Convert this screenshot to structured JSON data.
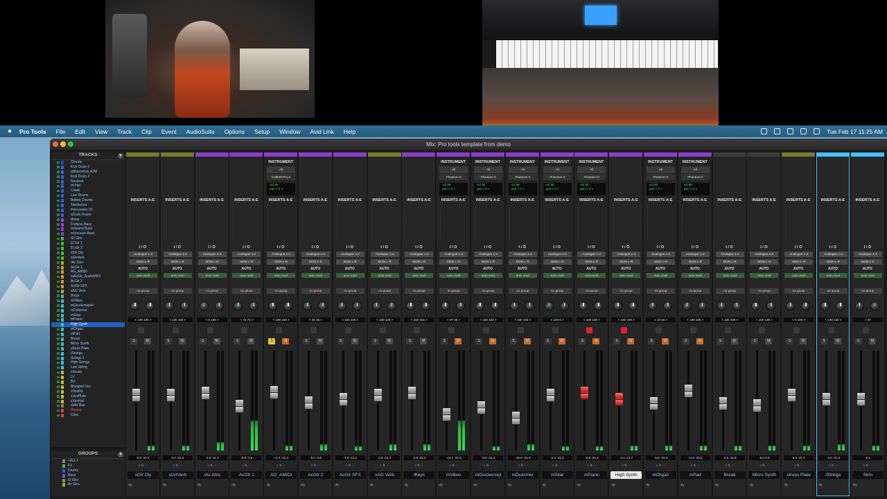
{
  "menubar": {
    "app_name": "Pro Tools",
    "items": [
      "File",
      "Edit",
      "View",
      "Track",
      "Clip",
      "Event",
      "AudioSuite",
      "Options",
      "Setup",
      "Window",
      "Avid Link",
      "Help"
    ],
    "clock": "Tue Feb 17  11:25 AM"
  },
  "window": {
    "title": "Mix: Pro tools template from demo"
  },
  "tracks_panel": {
    "title": "TRACKS",
    "tracks": [
      {
        "name": "/Drums",
        "color": "#1f4fbf"
      },
      {
        "name": "Kick Drum 1",
        "color": "#2f5fdf"
      },
      {
        "name": "mBoomKick A2M",
        "color": "#2f5fdf"
      },
      {
        "name": "Kick Drum 2",
        "color": "#2f5fdf"
      },
      {
        "name": "Rimshot",
        "color": "#2f5fdf"
      },
      {
        "name": "Hi Hat",
        "color": "#2f5fdf"
      },
      {
        "name": "Crash",
        "color": "#2f5fdf"
      },
      {
        "name": "Live Drums",
        "color": "#2f5fdf"
      },
      {
        "name": "Belted_Drums",
        "color": "#2f5fdf"
      },
      {
        "name": "Tamborine",
        "color": "#2f5fdf"
      },
      {
        "name": "Percussion 03",
        "color": "#2f5fdf"
      },
      {
        "name": "sDrum Room",
        "color": "#2f5fdf"
      },
      {
        "name": "/Bass",
        "color": "#8a3fd8"
      },
      {
        "name": "Fretless Bass",
        "color": "#8a3fd8"
      },
      {
        "name": "mXpand Bass",
        "color": "#8a3fd8"
      },
      {
        "name": "mVacuum Bass",
        "color": "#8a3fd8"
      },
      {
        "name": "/El Gtrs",
        "color": "#3fbf3f"
      },
      {
        "name": "El Gtr 1",
        "color": "#3fbf3f"
      },
      {
        "name": "El Gtr 2",
        "color": "#3fbf3f"
      },
      {
        "name": "xGtr Dly",
        "color": "#3fbf3f"
      },
      {
        "name": "xGtrVerb",
        "color": "#3fbf3f"
      },
      {
        "name": "/Ac Gtrs",
        "color": "#bf9f3f"
      },
      {
        "name": "AcGtr 1",
        "color": "#bf9f3f"
      },
      {
        "name": "AG_AMIDI",
        "color": "#bf9f3f"
      },
      {
        "name": "mAcGtr_AudioMIDI",
        "color": "#bf9f3f"
      },
      {
        "name": "AcGtr 2",
        "color": "#bf9f3f"
      },
      {
        "name": "AcGtr SFX",
        "color": "#bf9f3f"
      },
      {
        "name": "xAG Verb",
        "color": "#bf9f3f"
      },
      {
        "name": "/Keys",
        "color": "#3fbfbf"
      },
      {
        "name": "mVibes",
        "color": "#3fbfbf"
      },
      {
        "name": "mGlockenspiel",
        "color": "#3fbfbf"
      },
      {
        "name": "mDulcimer",
        "color": "#3fbfbf"
      },
      {
        "name": "mSitar",
        "color": "#3fbfbf"
      },
      {
        "name": "mPiano",
        "color": "#3fbfbf"
      },
      {
        "name": "High Synth",
        "color": "#3fbfbf"
      },
      {
        "name": "mOrgan",
        "color": "#3fbfbf"
      },
      {
        "name": "mPad",
        "color": "#3fbfbf"
      },
      {
        "name": "Break",
        "color": "#3fbfbf"
      },
      {
        "name": "Micro Synth",
        "color": "#3fbfbf"
      },
      {
        "name": "xKeys Plate",
        "color": "#3fbfbf"
      },
      {
        "name": "/Strings",
        "color": "#3fbfff"
      },
      {
        "name": "Strings 1",
        "color": "#3fbfff"
      },
      {
        "name": "High Strings",
        "color": "#3fbfff"
      },
      {
        "name": "Low String",
        "color": "#3fbfff"
      },
      {
        "name": "/Vocals",
        "color": "#bfbf3f"
      },
      {
        "name": "LV",
        "color": "#bfbf3f"
      },
      {
        "name": "BV",
        "color": "#bfbf3f"
      },
      {
        "name": "Mangled Vox",
        "color": "#bfbf3f"
      },
      {
        "name": "xVoxDly",
        "color": "#bfbf3f"
      },
      {
        "name": "xVoxPlate",
        "color": "#bfbf3f"
      },
      {
        "name": "xVoxHall",
        "color": "#bfbf3f"
      },
      {
        "name": "aMix Bus",
        "color": "#7f7f7f"
      },
      {
        "name": "Bleeep",
        "color": "#df3f3f"
      },
      {
        "name": "Click",
        "color": "#df3f3f"
      }
    ]
  },
  "groups_panel": {
    "title": "GROUPS",
    "groups": [
      {
        "name": "<ALL>",
        "color": "#888888"
      },
      {
        "name": "FX",
        "color": "#3fbf3f"
      },
      {
        "name": "Drums",
        "color": "#2f5fdf"
      },
      {
        "name": "Bass",
        "color": "#8a3fd8"
      },
      {
        "name": "El Gtrs",
        "color": "#3fbf3f"
      },
      {
        "name": "Ac Gtrs",
        "color": "#bf9f3f"
      }
    ]
  },
  "mixer": {
    "labels": {
      "inserts": "INSERTS A-E",
      "io": "I / O",
      "auto": "AUTO",
      "instrument": "INSTRUMENT",
      "solo": "S",
      "mute": "M",
      "dly": "dly"
    },
    "strips": [
      {
        "name": "xGtr Dly",
        "color": "#7a7a2a",
        "inst": false,
        "in": "Analogue 1-2",
        "out": "MON L-R",
        "auto": "auto read",
        "group": "no group",
        "pan": "< 100  100 >",
        "vol": "0.0   -31.3",
        "fader": 0.55,
        "meter": 0.05,
        "kl": false,
        "kr": false,
        "folder": false,
        "sel": false
      },
      {
        "name": "xGrtVerb",
        "color": "#7a7a2a",
        "inst": false,
        "in": "Analogue 1-2",
        "out": "MON L-R",
        "auto": "auto read",
        "group": "no group",
        "pan": "< 100  100 >",
        "vol": "0.0   -31.3",
        "fader": 0.55,
        "meter": 0.05,
        "kl": false,
        "kr": false,
        "folder": false,
        "sel": false
      },
      {
        "name": "/Ac Gtrs",
        "color": "#8a3fc8",
        "inst": false,
        "in": "Analogue 1-2",
        "out": "MON L-R",
        "auto": "auto read",
        "group": "no group",
        "pan": "< 0   100 >",
        "vol": "-2.0  -31.3",
        "fader": 0.57,
        "meter": 0.08,
        "kl": true,
        "kr": false,
        "folder": true,
        "sel": false
      },
      {
        "name": "AcGtr 1",
        "color": "#8a3fc8",
        "inst": false,
        "in": "Analogue 1-2",
        "out": "MON L-R",
        "auto": "auto read",
        "group": "no group",
        "pan": "< 72   73 >",
        "vol": "-8.0  -3.6",
        "fader": 0.42,
        "meter": 0.3,
        "kl": true,
        "kr": true,
        "folder": false,
        "sel": false
      },
      {
        "name": "AG_AMIDI",
        "color": "#8a3fc8",
        "inst": true,
        "inst_out": "C2MIDI Pro-2",
        "inst_vol": "vol  96",
        "inst_pan": "pan > 0 <",
        "in": "Analogue 1-2",
        "out": "MON L-R",
        "auto": "auto read",
        "group": "no group",
        "pan": "< 100  100 >",
        "vol": "+2.3  -31.3",
        "fader": 0.58,
        "meter": 0.05,
        "kl": false,
        "kr": false,
        "folder": false,
        "sel": false,
        "solo_on": true
      },
      {
        "name": "AcGtr 2",
        "color": "#8a3fc8",
        "inst": false,
        "in": "Analogue 1-2",
        "out": "MON L-R",
        "auto": "auto read",
        "group": "no group",
        "pan": "< 29   35 >",
        "vol": "-6.2  -5.6",
        "fader": 0.46,
        "meter": 0.06,
        "kl": true,
        "kr": true,
        "folder": false,
        "sel": false
      },
      {
        "name": "AcGtr SFX",
        "color": "#8a3fc8",
        "inst": false,
        "in": "Analogue 1-2",
        "out": "MON L-R",
        "auto": "auto read",
        "group": "no group",
        "pan": "< 100  100 >",
        "vol": "-7.0  -12.2",
        "fader": 0.5,
        "meter": 0.04,
        "kl": false,
        "kr": false,
        "folder": false,
        "sel": false
      },
      {
        "name": "xAG Verb",
        "color": "#7a7a2a",
        "inst": false,
        "in": "Analogue 1-2",
        "out": "MON L-R",
        "auto": "auto read",
        "group": "no group",
        "pan": "< 100  100 >",
        "vol": "0.0   -31.3",
        "fader": 0.55,
        "meter": 0.06,
        "kl": false,
        "kr": false,
        "folder": false,
        "sel": false
      },
      {
        "name": "/Keys",
        "color": "#8a3fc8",
        "inst": false,
        "in": "Analogue 1-2",
        "out": "MON L-R",
        "auto": "auto read",
        "group": "no group",
        "pan": "< 100  100 >",
        "vol": "-2.0  -31.3",
        "fader": 0.57,
        "meter": 0.06,
        "kl": false,
        "kr": false,
        "folder": true,
        "sel": false
      },
      {
        "name": "mVibes",
        "color": "#8a3fc8",
        "inst": true,
        "inst_out": "Phantom 0",
        "inst_vol": "vol  96",
        "inst_pan": "pan > 0 <",
        "in": "Analogue 1-2",
        "out": "MON L-R",
        "auto": "auto read",
        "group": "no group",
        "pan": "< 97   20 >",
        "vol": "-13.1 -31.3",
        "fader": 0.32,
        "meter": 0.3,
        "kl": false,
        "kr": true,
        "folder": false,
        "sel": false
      },
      {
        "name": "mGlockenspl",
        "color": "#8a3fc8",
        "inst": true,
        "inst_out": "Phantom 0",
        "inst_vol": "vol  96",
        "inst_pan": "pan > 0 <",
        "in": "Analogue 1-2",
        "out": "MON L-R",
        "auto": "auto read",
        "group": "no group",
        "pan": "< 100  100 >",
        "vol": "-8.0  -31.3",
        "fader": 0.4,
        "meter": 0.04,
        "kl": false,
        "kr": false,
        "folder": false,
        "sel": false
      },
      {
        "name": "mDulcimer",
        "color": "#8a3fc8",
        "inst": true,
        "inst_out": "Phantom 0",
        "inst_vol": "vol  96",
        "inst_pan": "pan > 0 <",
        "in": "Analogue 1-2",
        "out": "MON L-R",
        "auto": "auto read",
        "group": "no group",
        "pan": "< 100  100 >",
        "vol": "-15.6 -31.3",
        "fader": 0.28,
        "meter": 0.06,
        "kl": false,
        "kr": false,
        "folder": false,
        "sel": false
      },
      {
        "name": "mSitar",
        "color": "#8a3fc8",
        "inst": true,
        "inst_out": "Phantom 0",
        "inst_vol": "vol  96",
        "inst_pan": "pan > 0 <",
        "in": "Analogue 1-2",
        "out": "MON L-R",
        "auto": "auto read",
        "group": "no group",
        "pan": "< 100  0 >",
        "vol": "-2.2  -31.3",
        "fader": 0.55,
        "meter": 0.04,
        "kl": true,
        "kr": false,
        "folder": false,
        "sel": false
      },
      {
        "name": "mPiano",
        "color": "#8a3fc8",
        "inst": true,
        "inst_out": "Phantom 0",
        "inst_vol": "vol  96",
        "inst_pan": "pan > 0 <",
        "in": "Analogue 1-2",
        "out": "MON L-R",
        "auto": "auto read",
        "group": "no group",
        "pan": "< 100  100 >",
        "vol": "-0.8  -31.3",
        "fader": 0.57,
        "meter": 0.04,
        "kl": false,
        "kr": false,
        "folder": false,
        "sel": false,
        "red_fader": true,
        "rec_on": true
      },
      {
        "name": "High Synth",
        "color": "#8a3fc8",
        "inst": false,
        "in": "Analogue 1-2",
        "out": "MON L-R",
        "auto": "auto read",
        "group": "no group",
        "pan": "< 100  100 >",
        "vol": "-4.4  -14.7",
        "fader": 0.5,
        "meter": 0.05,
        "kl": false,
        "kr": false,
        "folder": false,
        "sel": true,
        "red_fader": true,
        "rec_on": true
      },
      {
        "name": "mOrgan",
        "color": "#8a3fc8",
        "inst": true,
        "inst_out": "Phantom 0",
        "inst_vol": "vol  96",
        "inst_pan": "pan > 0 <",
        "in": "Analogue 1-2",
        "out": "MON L-R",
        "auto": "auto read",
        "group": "no group",
        "pan": "< 18   19 >",
        "vol": "-6.6  -31.3",
        "fader": 0.45,
        "meter": 0.05,
        "kl": true,
        "kr": true,
        "folder": false,
        "sel": false
      },
      {
        "name": "mPad",
        "color": "#8a3fc8",
        "inst": true,
        "inst_out": "Phantom 0",
        "inst_vol": "vol  96",
        "inst_pan": "pan > 0 <",
        "in": "Analogue 1-2",
        "out": "MON L-R",
        "auto": "auto read",
        "group": "no group",
        "pan": "< 100  100 >",
        "vol": "+2.0  -31.3",
        "fader": 0.6,
        "meter": 0.05,
        "kl": false,
        "kr": false,
        "folder": false,
        "sel": false
      },
      {
        "name": "Break",
        "color": "#3a3a3a",
        "inst": false,
        "in": "Analogue 1-2",
        "out": "MON L-R",
        "auto": "auto read",
        "group": "no group",
        "pan": "< 100  100 >",
        "vol": "-5.6  -11.8",
        "fader": 0.45,
        "meter": 0.05,
        "kl": false,
        "kr": false,
        "folder": false,
        "sel": false
      },
      {
        "name": "Micro Synth",
        "color": "#3a3a3a",
        "inst": false,
        "in": "Analogue 1-2",
        "out": "MON L-R",
        "auto": "auto read",
        "group": "no group",
        "pan": "< 100  100 >",
        "vol": "-6.0   0.0",
        "fader": 0.43,
        "meter": 0.05,
        "kl": false,
        "kr": true,
        "folder": false,
        "sel": false
      },
      {
        "name": "xKeys Plate",
        "color": "#7a7a2a",
        "inst": false,
        "in": "Analogue 1-2",
        "out": "MON L-R",
        "auto": "auto read",
        "group": "no group",
        "pan": "< 0   100 >",
        "vol": "0.0   -31.3",
        "fader": 0.55,
        "meter": 0.05,
        "kl": true,
        "kr": false,
        "folder": false,
        "sel": false
      },
      {
        "name": "/Strings",
        "color": "#3fc3ff",
        "inst": false,
        "in": "Analogue 1-2",
        "out": "MON L-R",
        "auto": "auto read",
        "group": "no group",
        "pan": "< 100  100 >",
        "vol": "-3.0  -31.3",
        "fader": 0.5,
        "meter": 0.06,
        "kl": false,
        "kr": false,
        "folder": true,
        "sel": true
      },
      {
        "name": "Strin",
        "color": "#3fc3ff",
        "inst": false,
        "in": "Analogue 1-2",
        "out": "MON L-R",
        "auto": "auto read",
        "group": "no group",
        "pan": "< 47",
        "vol": "-6.1",
        "fader": 0.5,
        "meter": 0.05,
        "kl": false,
        "kr": true,
        "folder": false,
        "sel": false
      }
    ]
  }
}
